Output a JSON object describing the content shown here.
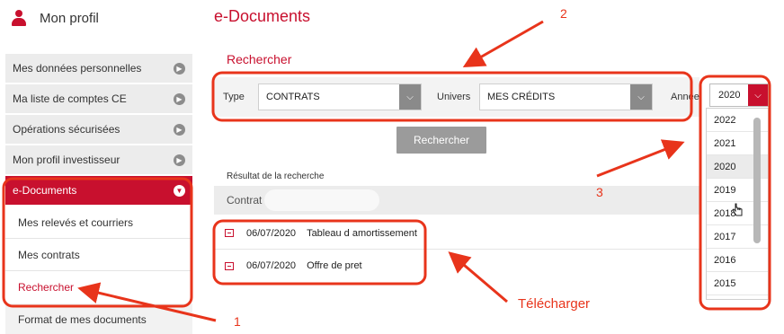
{
  "profile": {
    "title": "Mon profil",
    "icon": "user-icon"
  },
  "sidebar": {
    "items": [
      {
        "label": "Mes données personnelles"
      },
      {
        "label": "Ma liste de comptes CE"
      },
      {
        "label": "Opérations sécurisées"
      },
      {
        "label": "Mon profil investisseur"
      }
    ],
    "active": {
      "label": "e-Documents"
    },
    "sub_items": [
      {
        "label": "Mes relevés et courriers"
      },
      {
        "label": "Mes contrats"
      },
      {
        "label": "Rechercher"
      }
    ],
    "after": {
      "label": "Format de mes documents"
    }
  },
  "main": {
    "title": "e-Documents",
    "section_title": "Rechercher",
    "filters": {
      "type_label": "Type",
      "type_value": "CONTRATS",
      "univers_label": "Univers",
      "univers_value": "MES CRÉDITS",
      "annee_label": "Année",
      "annee_value": "2020"
    },
    "search_button": "Rechercher",
    "results_label": "Résultat de la recherche",
    "contrat_label": "Contrat",
    "documents": [
      {
        "date": "06/07/2020",
        "title": "Tableau d amortissement"
      },
      {
        "date": "06/07/2020",
        "title": "Offre de pret"
      }
    ]
  },
  "year_dropdown": {
    "options": [
      "2022",
      "2021",
      "2020",
      "2019",
      "2018",
      "2017",
      "2016",
      "2015"
    ],
    "selected": "2020"
  },
  "annotations": {
    "n1": "1",
    "n2": "2",
    "n3": "3",
    "telecharger": "Télécharger"
  },
  "colors": {
    "accent": "#c8102e",
    "annotation": "#e8341b"
  }
}
